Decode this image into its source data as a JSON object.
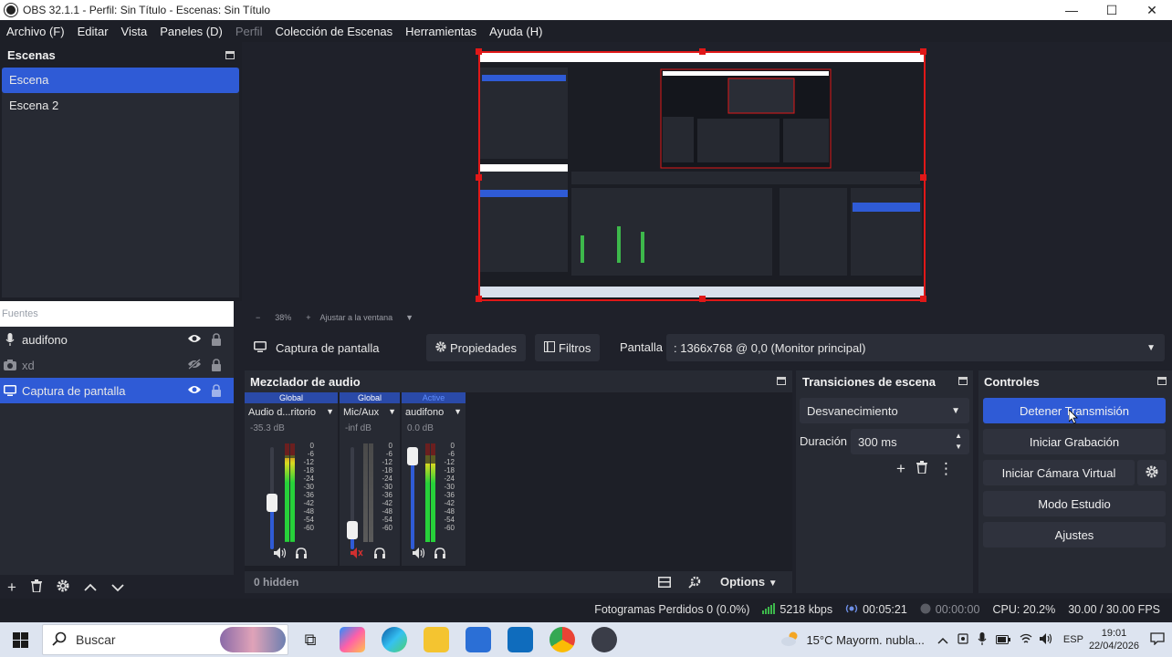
{
  "window": {
    "title": "OBS 32.1.1 - Perfil: Sin Título - Escenas: Sin Título",
    "minimize": "—",
    "maximize": "☐",
    "close": "✕"
  },
  "menu": [
    {
      "label": "Archivo (F)",
      "enabled": true
    },
    {
      "label": "Editar",
      "enabled": true
    },
    {
      "label": "Vista",
      "enabled": true
    },
    {
      "label": "Paneles (D)",
      "enabled": true
    },
    {
      "label": "Perfil",
      "enabled": false
    },
    {
      "label": "Colección de Escenas",
      "enabled": true
    },
    {
      "label": "Herramientas",
      "enabled": true
    },
    {
      "label": "Ayuda (H)",
      "enabled": true
    }
  ],
  "scenes": {
    "title": "Escenas",
    "items": [
      "Escena",
      "Escena 2"
    ],
    "selected": 0
  },
  "preview": {
    "zoom": "38%",
    "fit_label": "Ajustar a la ventana",
    "minus": "−",
    "plus": "+"
  },
  "sources": {
    "title": "Fuentes",
    "items": [
      {
        "label": "audifono",
        "icon": "mic-icon",
        "visible": true
      },
      {
        "label": "xd",
        "icon": "camera-icon",
        "visible": false
      },
      {
        "label": "Captura de pantalla",
        "icon": "monitor-icon",
        "visible": true
      }
    ],
    "selected": 2
  },
  "context": {
    "source_name": "Captura de pantalla",
    "properties": "Propiedades",
    "filters": "Filtros",
    "display_label": "Pantalla",
    "display_value": ": 1366x768 @ 0,0 (Monitor principal)"
  },
  "mixer": {
    "title": "Mezclador de audio",
    "channels": [
      {
        "tag": "Global",
        "name": "Audio d...ritorio",
        "db": "-35.3 dB",
        "level": 0.85,
        "fader": 0.45
      },
      {
        "tag": "Global",
        "name": "Mic/Aux",
        "db": "-inf dB",
        "level": 0,
        "fader": 0.12
      },
      {
        "tag": "Active",
        "name": "audifono",
        "db": "0.0 dB",
        "level": 0.8,
        "fader": 1.0
      }
    ],
    "ticks": [
      "0",
      "-6",
      "-12",
      "-18",
      "-24",
      "-30",
      "-36",
      "-42",
      "-48",
      "-54",
      "-60"
    ],
    "hidden": "0 hidden",
    "options": "Options"
  },
  "transitions": {
    "title": "Transiciones de escena",
    "type": "Desvanecimiento",
    "duration_label": "Duración",
    "duration": "300 ms"
  },
  "controls": {
    "title": "Controles",
    "stop_stream": "Detener Transmisión",
    "start_record": "Iniciar Grabación",
    "start_vcam": "Iniciar Cámara Virtual",
    "studio": "Modo Estudio",
    "settings": "Ajustes"
  },
  "status": {
    "dropped": "Fotogramas Perdidos 0 (0.0%)",
    "bitrate": "5218 kbps",
    "stream_time": "00:05:21",
    "record_time": "00:00:00",
    "cpu": "CPU: 20.2%",
    "fps": "30.00 / 30.00 FPS"
  },
  "taskbar": {
    "search_placeholder": "Buscar",
    "weather": "15°C  Mayorm. nubla...",
    "lang": "ESP",
    "time": "19:01",
    "date": "22/04/2026"
  },
  "colors": {
    "accent": "#2f5bd6",
    "selection_border": "#e01818",
    "panel": "#272a33",
    "background": "#1f212a"
  }
}
